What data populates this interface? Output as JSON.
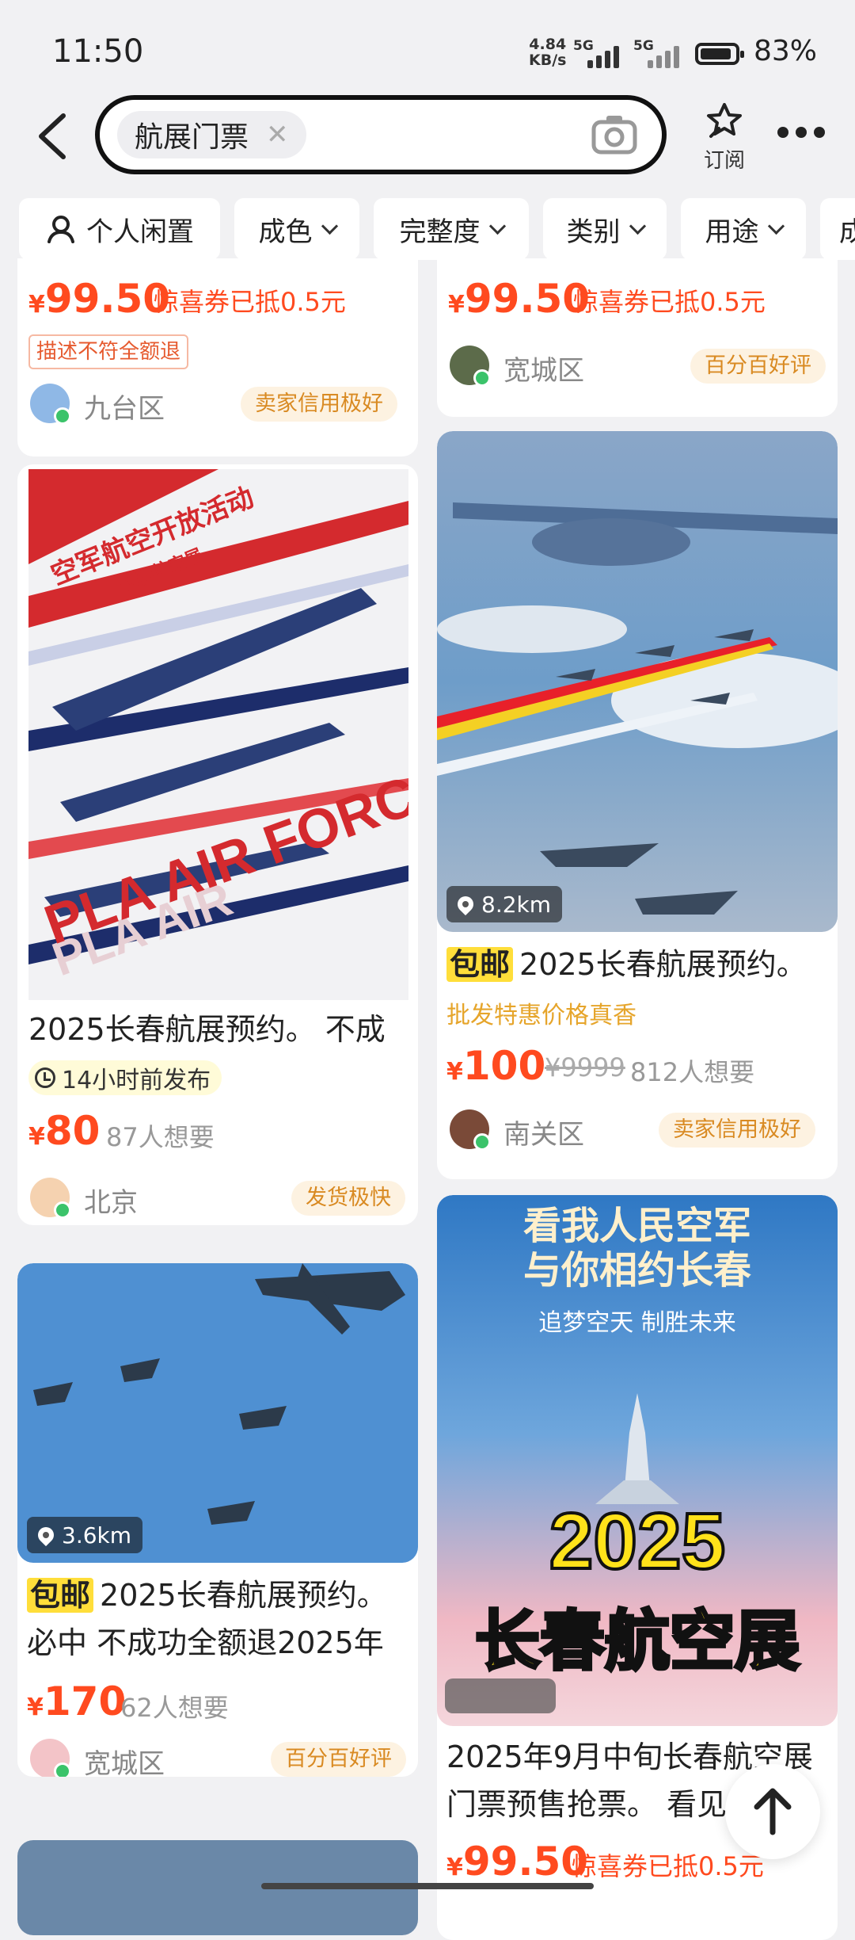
{
  "status_bar": {
    "time": "11:50",
    "net_speed_top": "4.84",
    "net_speed_bottom": "KB/s",
    "sim1": "5G",
    "sim2": "5G",
    "battery": "83%"
  },
  "search": {
    "query": "航展门票",
    "subscribe_label": "订阅"
  },
  "filters": [
    "个人闲置",
    "成色",
    "完整度",
    "类别",
    "用途",
    "成"
  ],
  "listings": {
    "l0": {
      "currency": "¥",
      "price": "99.50",
      "coupon": "惊喜券已抵0.5元",
      "tag": "描述不符全额退",
      "location": "九台区",
      "badge": "卖家信用极好"
    },
    "r0": {
      "currency": "¥",
      "price": "99.50",
      "coupon": "惊喜券已抵0.5元",
      "location": "宽城区",
      "badge": "百分百好评"
    },
    "l1": {
      "poster_text1": "空军航空开放活动",
      "poster_text2": "长春航空展",
      "poster_brand": "PLA AIR FORCE",
      "title": "2025长春航展预约。 不成",
      "time": "14小时前发布",
      "currency": "¥",
      "price": "80",
      "want": "87人想要",
      "location": "北京",
      "badge": "发货极快"
    },
    "r1": {
      "distance": "8.2km",
      "baoyou": "包邮",
      "title": "2025长春航展预约。",
      "tagline": "批发特惠价格真香",
      "currency": "¥",
      "price": "100",
      "orig_price": "¥9999",
      "want": "812人想要",
      "location": "南关区",
      "badge": "卖家信用极好"
    },
    "l2": {
      "distance": "3.6km",
      "baoyou": "包邮",
      "title_line1": "2025长春航展预约。",
      "title_line2": "必中 不成功全额退2025年",
      "currency": "¥",
      "price": "170",
      "want": "62人想要",
      "location": "宽城区",
      "badge": "百分百好评"
    },
    "r2": {
      "poster_top1": "看我人民空军",
      "poster_top2": "与你相约长春",
      "poster_sub": "追梦空天 制胜未来",
      "poster_year": "2025",
      "poster_big": "长春航空展",
      "title_line1": "2025年9月中旬长春航空展",
      "title_line2": "门票预售抢票。 看见",
      "currency": "¥",
      "price": "99.50",
      "coupon": "惊喜券已抵0.5元"
    }
  },
  "colors": {
    "price": "#ff4a1f",
    "badge_text": "#d98a22",
    "badge_bg": "#fdf2e1",
    "baoyou_bg": "#ffde3a"
  }
}
